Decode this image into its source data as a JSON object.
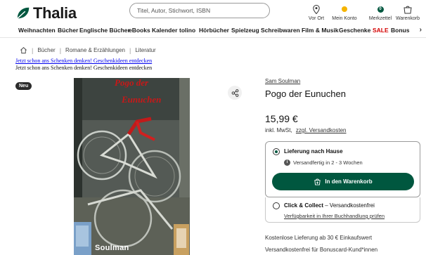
{
  "header": {
    "logo_text": "Thalia",
    "search_placeholder": "Titel, Autor, Stichwort, ISBN",
    "icons": [
      {
        "label": "Vor Ort",
        "icon": "location-pin-icon"
      },
      {
        "label": "Mein Konto",
        "icon": "account-icon"
      },
      {
        "label": "Merkzettel",
        "icon": "wishlist-icon",
        "badge": "0"
      },
      {
        "label": "Warenkorb",
        "icon": "cart-icon",
        "badge": "0"
      }
    ]
  },
  "categories": [
    "Weihnachten",
    "Bücher",
    "Englische Bücher",
    "eBooks",
    "Kalender",
    "tolino",
    "Hörbücher",
    "Spielzeug",
    "Schreibwaren",
    "Film & Musik",
    "Geschenke",
    "SALE",
    "Bonus"
  ],
  "breadcrumb": [
    "Bücher",
    "Romane & Erzählungen",
    "Literatur"
  ],
  "promo": {
    "link": "Jetzt schon ans Schenken denken! Geschenkideen entdecken",
    "text": "Jetzt schon ans Schenken denken! Geschenkideen entdecken"
  },
  "product": {
    "badge": "Neu",
    "cover_title_line1": "Pogo der",
    "cover_title_line2": "Eunuchen",
    "cover_author": "Soulman",
    "author": "Sam Soulman",
    "title": "Pogo der Eunuchen",
    "price": "15,99 €",
    "tax_text": "inkl. MwSt,",
    "shipping_link": "zzgl. Versandkosten"
  },
  "delivery": {
    "option1_label": "Lieferung nach Hause",
    "option1_availability": "Versandfertig in 2 - 3 Wochen",
    "cart_button": "In den Warenkorb",
    "option2_label": "Click & Collect",
    "option2_suffix": "– Versandkostenfrei",
    "option2_link": "Verfügbarkeit in Ihrer Buchhandlung prüfen"
  },
  "shipping_notes": [
    "Kostenlose Lieferung ab 30 € Einkaufswert",
    "Versandkostenfrei für Bonuscard-Kund*innen"
  ],
  "colors": {
    "brand_green": "#00573f",
    "sale_red": "#d40000",
    "account_dot": "#f5b400"
  }
}
